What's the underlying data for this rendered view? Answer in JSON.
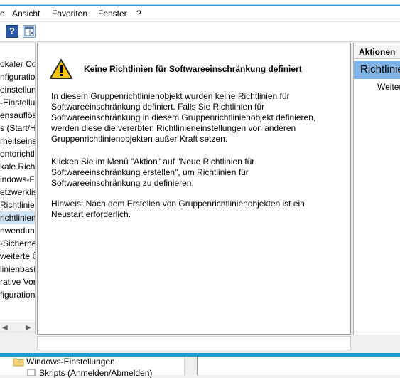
{
  "menubar": {
    "items": [
      "e",
      "Ansicht",
      "Favoriten",
      "Fenster",
      "?"
    ]
  },
  "toolbar": {
    "help_icon": "help-icon",
    "help_label": "?",
    "panel_icon": "show-action-pane-icon"
  },
  "left_tree": {
    "items": [
      {
        "label": "okaler Co",
        "selected": false
      },
      {
        "label": "nfiguratio",
        "selected": false
      },
      {
        "label": "einstellun",
        "selected": false
      },
      {
        "label": "-Einstellu",
        "selected": false
      },
      {
        "label": "ensauflösu",
        "selected": false
      },
      {
        "label": "s (Start/H",
        "selected": false
      },
      {
        "label": "rheitseins",
        "selected": false
      },
      {
        "label": "ontorichtl",
        "selected": false
      },
      {
        "label": "kale Richt",
        "selected": false
      },
      {
        "label": "indows-Fi",
        "selected": false
      },
      {
        "label": "etzwerklis",
        "selected": false
      },
      {
        "label": "Richtlinien",
        "selected": false
      },
      {
        "label": "richtlinien",
        "selected": true
      },
      {
        "label": "nwendun",
        "selected": false
      },
      {
        "label": "-Sicherhe",
        "selected": false
      },
      {
        "label": "weiterte Ü",
        "selected": false
      },
      {
        "label": "linienbasi",
        "selected": false
      },
      {
        "label": "rative Vor",
        "selected": false
      },
      {
        "label": "figuration",
        "selected": false
      }
    ],
    "scroll_left": "◀",
    "scroll_right": "▶"
  },
  "content": {
    "warning_icon": "warning-icon",
    "heading": "Keine Richtlinien für Softwareeinschränkung definiert",
    "paragraph1": "In diesem Gruppenrichtlinienobjekt wurden keine Richtlinien für\nSoftwareeinschränkung definiert. Falls Sie Richtlinien für\nSoftwareeinschränkung in diesem Gruppenrichtlinienobjekt definieren,\nwerden diese die vererbten Richtlinieneinstellungen von anderen\nGruppenrichtlinienobjekten außer Kraft setzen.",
    "paragraph2": "Klicken Sie im Menü \"Aktion\" auf \"Neue Richtlinien für\nSoftwareeinschränkung erstellen\", um Richtlinien für\nSoftwareeinschränkung zu definieren.",
    "paragraph3": "Hinweis: Nach dem Erstellen von Gruppenrichtlinienobjekten ist ein\nNeustart erforderlich."
  },
  "actions_pane": {
    "header": "Aktionen",
    "section_title": "Richtlinien",
    "more_link": "Weiter"
  },
  "bottom_window": {
    "items": [
      {
        "label": "Windows-Einstellungen",
        "icon": "folder-icon"
      },
      {
        "label": "Skripts (Anmelden/Abmelden)",
        "icon": "script-icon"
      }
    ]
  },
  "colors": {
    "accent": "#1e9ad6",
    "selection": "#cfe4f7",
    "action_section": "#7fb2e5"
  }
}
